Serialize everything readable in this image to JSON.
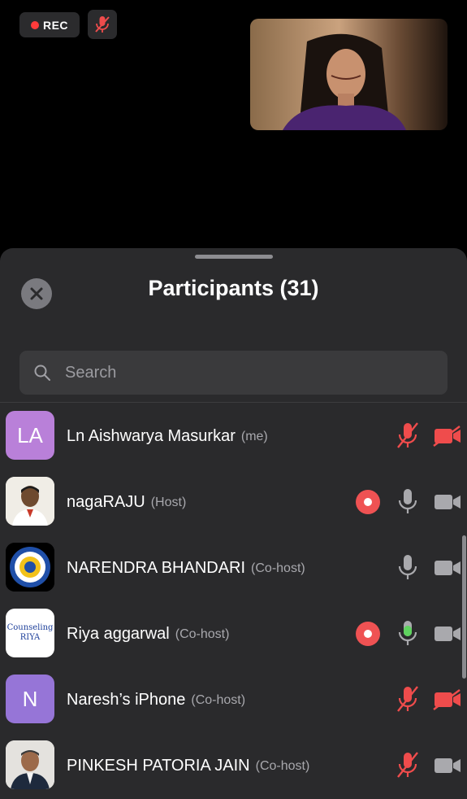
{
  "call": {
    "rec_label": "REC",
    "self_mic_state": "muted"
  },
  "panel": {
    "title": "Participants (31)",
    "search_placeholder": "Search"
  },
  "participants": [
    {
      "name": "Ln Aishwarya Masurkar",
      "role": "(me)",
      "avatar_text": "LA",
      "avatar": "initials-pink",
      "recording": false,
      "mic": "muted",
      "camera": "off"
    },
    {
      "name": "nagaRAJU",
      "role": "(Host)",
      "avatar_text": "",
      "avatar": "photo",
      "recording": true,
      "mic": "on",
      "camera": "on"
    },
    {
      "name": "NARENDRA BHANDARI",
      "role": "(Co-host)",
      "avatar_text": "",
      "avatar": "lions-logo",
      "recording": false,
      "mic": "on",
      "camera": "on"
    },
    {
      "name": "Riya aggarwal",
      "role": "(Co-host)",
      "avatar_text": "Counseling RIYA",
      "avatar": "logo-text",
      "recording": true,
      "mic": "speaking",
      "camera": "on"
    },
    {
      "name": "Naresh’s iPhone",
      "role": "(Co-host)",
      "avatar_text": "N",
      "avatar": "initials-violet",
      "recording": false,
      "mic": "muted",
      "camera": "off"
    },
    {
      "name": "PINKESH PATORIA JAIN",
      "role": "(Co-host)",
      "avatar_text": "",
      "avatar": "photo",
      "recording": false,
      "mic": "muted",
      "camera": "on"
    }
  ],
  "colors": {
    "muted_red": "#ef4c4c",
    "speaking_green": "#5fd35f",
    "icon_gray": "#a9a9ad",
    "record_red": "#ef5253"
  }
}
